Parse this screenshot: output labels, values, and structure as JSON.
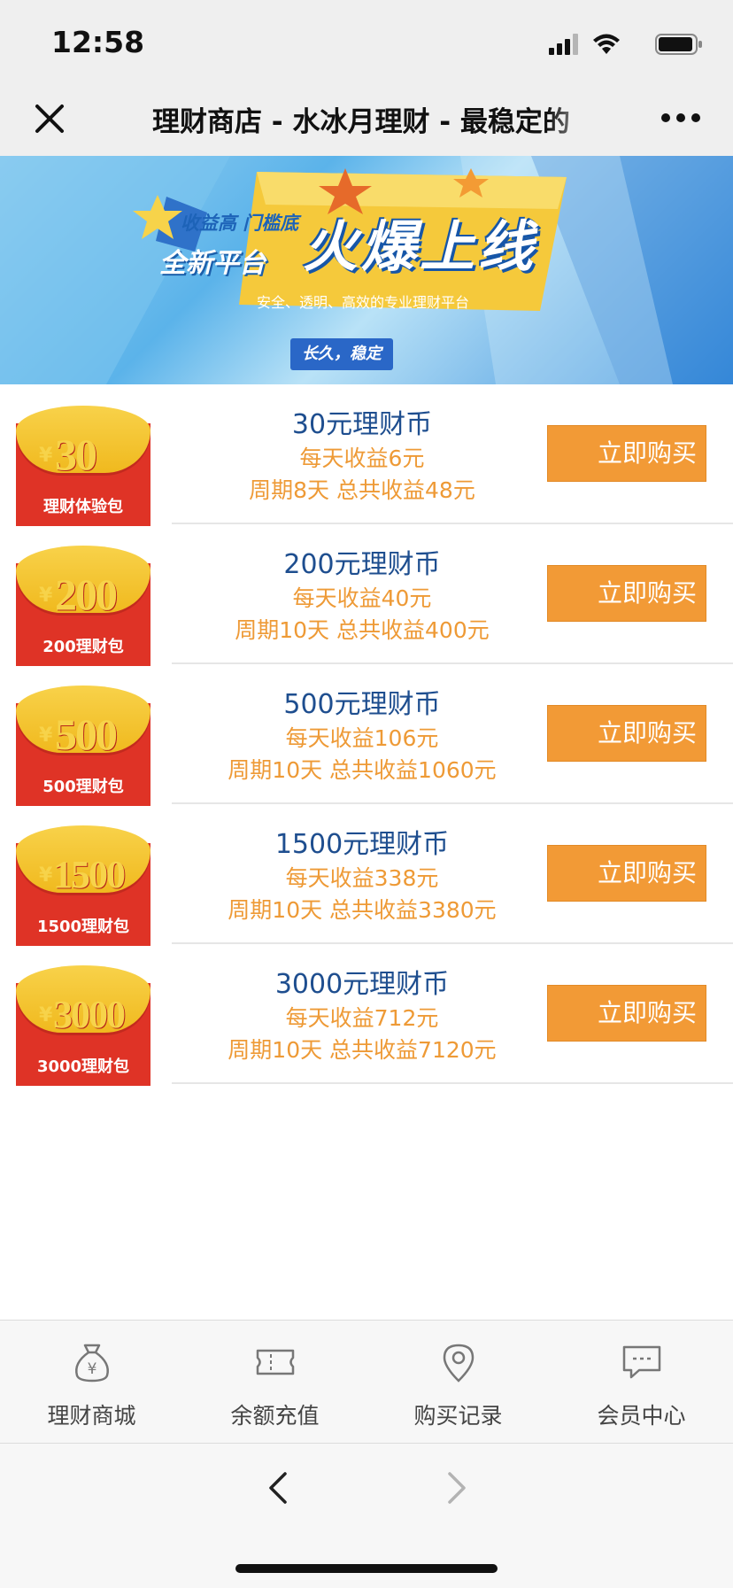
{
  "status_bar": {
    "time": "12:58",
    "icons": [
      "signal-icon",
      "wifi-icon",
      "battery-icon"
    ]
  },
  "nav": {
    "title": "理财商店 - 水冰月理财 - 最稳定的",
    "close_icon": "close-icon",
    "more_icon": "more-icon"
  },
  "banner": {
    "tag1": "收益高 门槛底",
    "tag2": "全新平台",
    "headline": "火爆上线",
    "subtitle": "安全、透明、高效的专业理财平台",
    "badge": "长久，稳定"
  },
  "products": [
    {
      "amount": "30",
      "envelope_label": "理财体验包",
      "name": "30元理财币",
      "daily": "每天收益6元",
      "period": "周期8天 总共收益48元",
      "button": "立即购买"
    },
    {
      "amount": "200",
      "envelope_label": "200理财包",
      "name": "200元理财币",
      "daily": "每天收益40元",
      "period": "周期10天 总共收益400元",
      "button": "立即购买"
    },
    {
      "amount": "500",
      "envelope_label": "500理财包",
      "name": "500元理财币",
      "daily": "每天收益106元",
      "period": "周期10天 总共收益1060元",
      "button": "立即购买"
    },
    {
      "amount": "1500",
      "envelope_label": "1500理财包",
      "name": "1500元理财币",
      "daily": "每天收益338元",
      "period": "周期10天 总共收益3380元",
      "button": "立即购买"
    },
    {
      "amount": "3000",
      "envelope_label": "3000理财包",
      "name": "3000元理财币",
      "daily": "每天收益712元",
      "period": "周期10天 总共收益7120元",
      "button": "立即购买"
    }
  ],
  "envelope_yen": "¥",
  "tabs": [
    {
      "label": "理财商城",
      "icon": "money-bag-icon"
    },
    {
      "label": "余额充值",
      "icon": "ticket-icon"
    },
    {
      "label": "购买记录",
      "icon": "location-pin-icon"
    },
    {
      "label": "会员中心",
      "icon": "chat-bubble-icon"
    }
  ],
  "browser": {
    "back_icon": "chevron-left-icon",
    "forward_icon": "chevron-right-icon"
  },
  "colors": {
    "title_blue": "#1e4e8f",
    "accent_orange": "#f29a36",
    "envelope_red": "#df3326",
    "envelope_gold": "#f7d34a"
  }
}
